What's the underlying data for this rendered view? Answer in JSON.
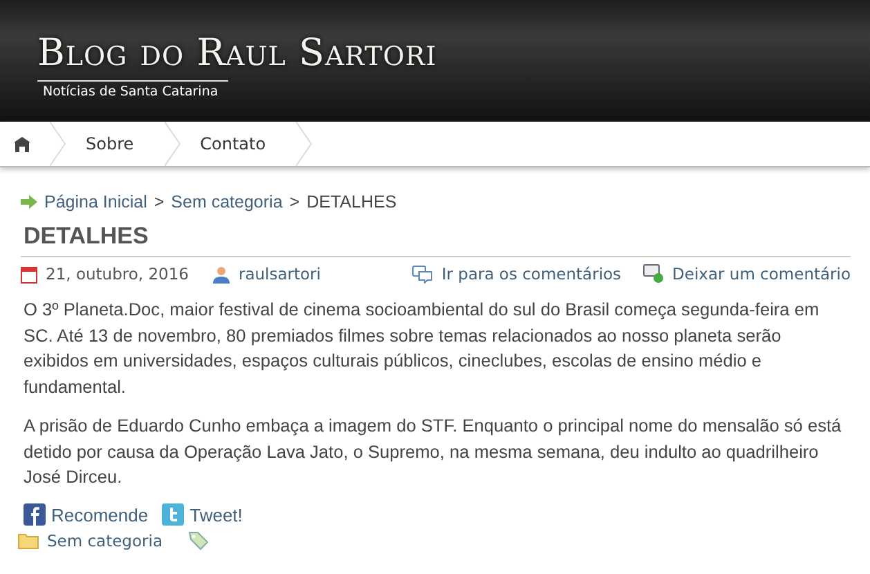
{
  "header": {
    "title": "Blog do Raul Sartori",
    "subtitle": "Notícias de Santa Catarina"
  },
  "nav": {
    "items": [
      {
        "kind": "home"
      },
      {
        "kind": "text",
        "label": "Sobre"
      },
      {
        "kind": "text",
        "label": "Contato"
      }
    ]
  },
  "breadcrumb": [
    {
      "label": "Página Inicial",
      "link": true
    },
    {
      "label": ">",
      "link": false
    },
    {
      "label": "Sem categoria",
      "link": true
    },
    {
      "label": ">",
      "link": false
    },
    {
      "label": "DETALHES",
      "link": false
    }
  ],
  "post": {
    "title": "DETALHES",
    "date": "21, outubro, 2016",
    "author": "raulsartori",
    "comments_link": "Ir para os comentários",
    "leave_comment": "Deixar um comentário",
    "paragraphs": [
      "O 3º Planeta.Doc, maior festival de cinema socioambiental do sul do Brasil começa segunda-feira em SC. Até 13 de novembro, 80 premiados filmes sobre temas relacionados ao nosso planeta serão exibidos em universidades, espaços culturais públicos, cineclubes, escolas de ensino médio e fundamental.",
      "A prisão de Eduardo Cunho embaça a imagem do STF. Enquanto o principal nome do mensalão só está detido por causa da Operação Lava Jato, o Supremo, na mesma semana, deu indulto ao quadrilheiro José Dirceu."
    ],
    "share": [
      "Recomende",
      "Tweet!"
    ],
    "category": "Sem categoria"
  }
}
